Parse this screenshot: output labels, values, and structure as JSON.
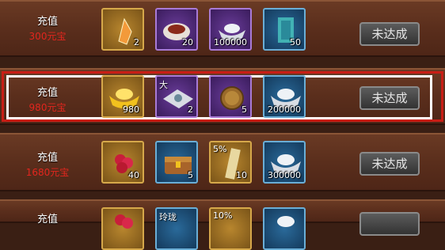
{
  "rows": [
    {
      "label": "充值",
      "amount": "300元宝",
      "items": [
        {
          "icon": "orange-crystal-icon",
          "qty": "2",
          "corner": ""
        },
        {
          "icon": "meat-plate-icon",
          "qty": "20",
          "corner": ""
        },
        {
          "icon": "silver-ingot-icon",
          "qty": "100000",
          "corner": ""
        },
        {
          "icon": "jade-scroll-icon",
          "qty": "50",
          "corner": ""
        }
      ],
      "button": "未达成"
    },
    {
      "label": "充值",
      "amount": "980元宝",
      "items": [
        {
          "icon": "gold-ingot-icon",
          "qty": "980",
          "corner": ""
        },
        {
          "icon": "pearl-cloth-icon",
          "qty": "2",
          "corner": "大"
        },
        {
          "icon": "bronze-coin-icon",
          "qty": "5",
          "corner": ""
        },
        {
          "icon": "silver-ingot-icon",
          "qty": "200000",
          "corner": ""
        }
      ],
      "button": "未达成"
    },
    {
      "label": "充值",
      "amount": "1680元宝",
      "items": [
        {
          "icon": "red-berries-icon",
          "qty": "40",
          "corner": ""
        },
        {
          "icon": "treasure-chest-icon",
          "qty": "5",
          "corner": ""
        },
        {
          "icon": "percent-scroll-icon",
          "qty": "10",
          "corner": "5%"
        },
        {
          "icon": "silver-ingot-icon",
          "qty": "300000",
          "corner": ""
        }
      ],
      "button": "未达成"
    },
    {
      "label": "充值",
      "amount": "",
      "items": [
        {
          "icon": "red-berries-icon",
          "qty": "",
          "corner": ""
        },
        {
          "icon": "jade-token-icon",
          "qty": "",
          "corner": "玲珑"
        },
        {
          "icon": "percent-scroll-icon",
          "qty": "",
          "corner": "10%"
        },
        {
          "icon": "silver-ingot-icon",
          "qty": "",
          "corner": ""
        }
      ],
      "button": ""
    }
  ],
  "colors": {
    "highlight_outer": "#c81e16",
    "highlight_inner": "#ffffff",
    "amount_text": "#e2261e"
  }
}
